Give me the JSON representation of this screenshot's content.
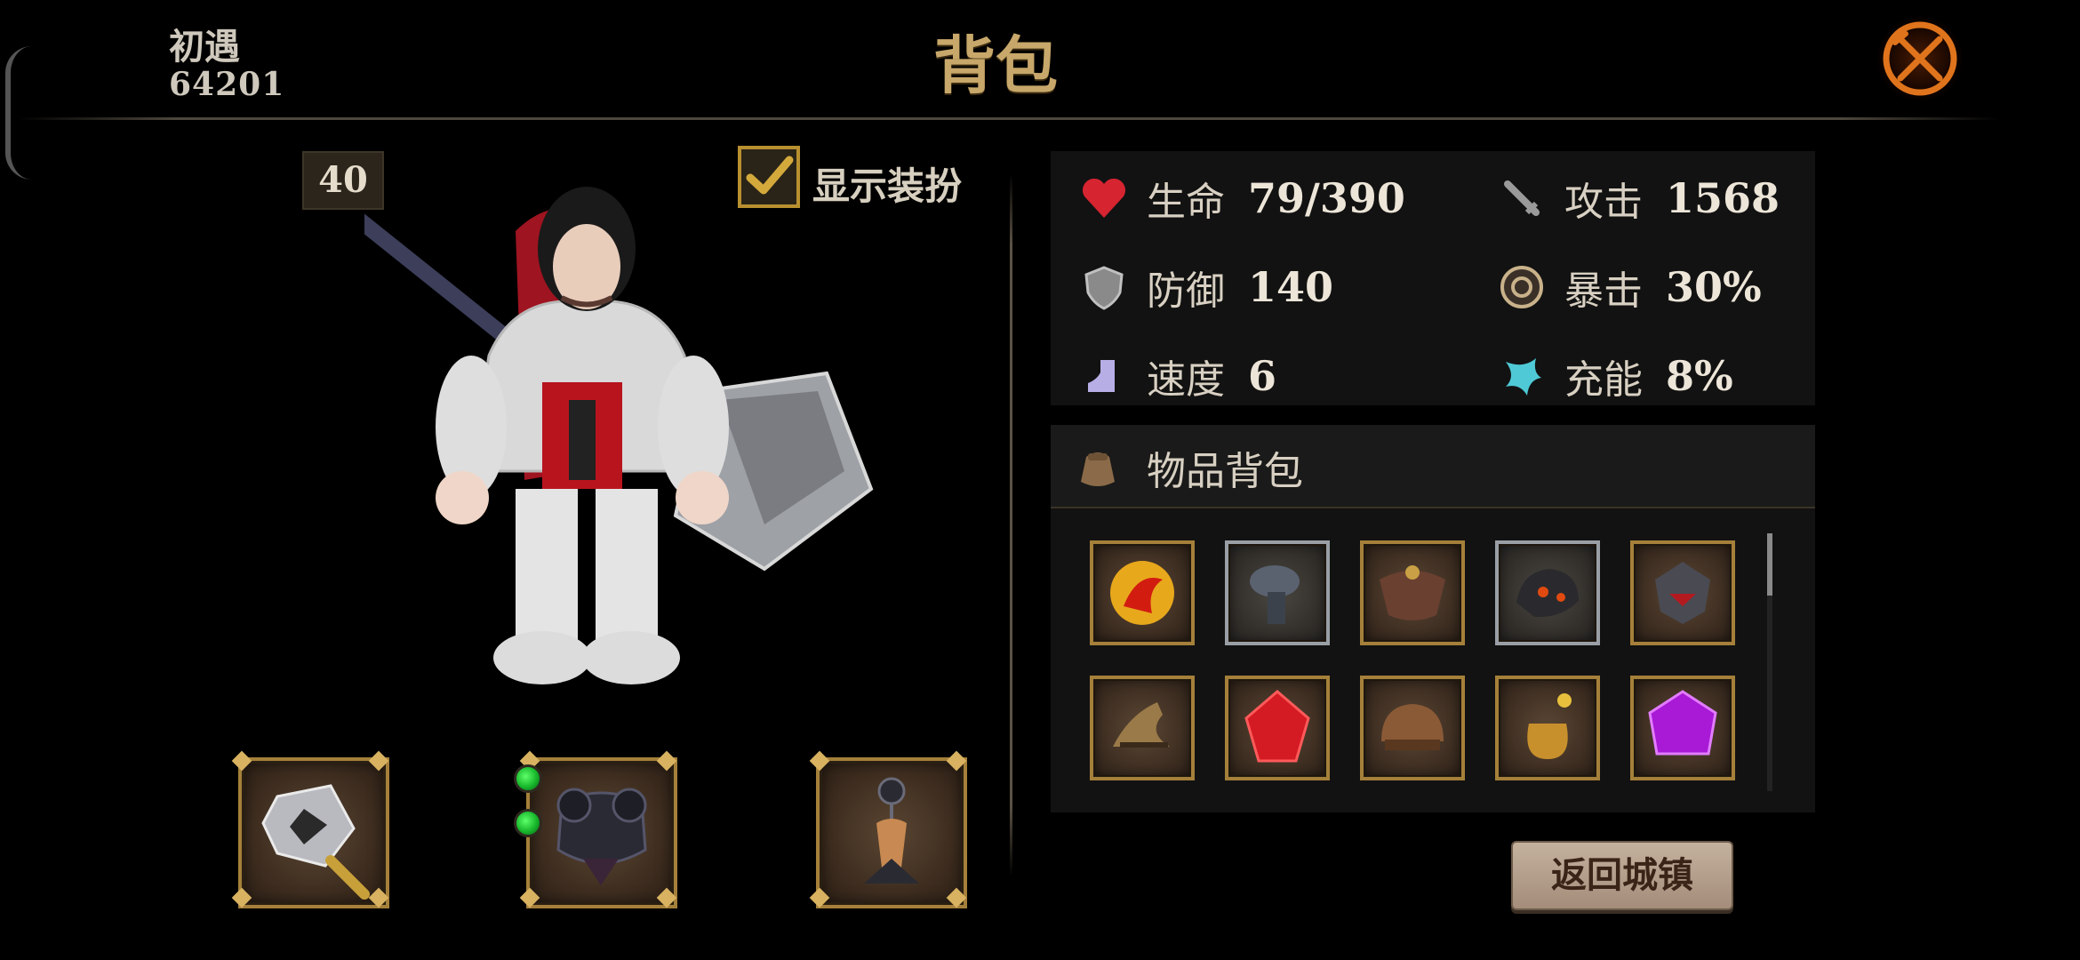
{
  "header": {
    "player_name": "初遇",
    "player_id": "64201",
    "title": "背包",
    "close_icon": "close-crossed-icon"
  },
  "character": {
    "level": "40",
    "show_outfit_label": "显示装扮",
    "show_outfit_checked": true
  },
  "stats": [
    {
      "icon": "heart-icon",
      "label": "生命",
      "value": "79/390"
    },
    {
      "icon": "sword-icon",
      "label": "攻击",
      "value": "1568"
    },
    {
      "icon": "shield-icon",
      "label": "防御",
      "value": "140"
    },
    {
      "icon": "crit-target-icon",
      "label": "暴击",
      "value": "30%"
    },
    {
      "icon": "boot-icon",
      "label": "速度",
      "value": "6"
    },
    {
      "icon": "energy-wing-icon",
      "label": "充能",
      "value": "8%"
    }
  ],
  "equipment": [
    {
      "icon": "spiked-mace-icon"
    },
    {
      "icon": "dark-armor-icon",
      "gems": 2
    },
    {
      "icon": "trinket-totem-icon"
    }
  ],
  "inventory": {
    "title": "物品背包",
    "title_icon": "bag-icon",
    "items": [
      {
        "icon": "fire-orb-icon"
      },
      {
        "icon": "iron-gauntlet-icon"
      },
      {
        "icon": "leather-shoulder-icon"
      },
      {
        "icon": "lava-stone-icon"
      },
      {
        "icon": "demon-helmet-icon"
      },
      {
        "icon": "golden-boot-icon"
      },
      {
        "icon": "red-gem-icon"
      },
      {
        "icon": "leather-cap-icon"
      },
      {
        "icon": "gold-pouch-icon"
      },
      {
        "icon": "purple-gem-icon"
      }
    ]
  },
  "return_button": "返回城镇",
  "colors": {
    "title_gold": "#c7a76a",
    "slot_border_gold": "#a5803a",
    "panel_bg": "#121212",
    "close_orange": "#e0741c"
  }
}
